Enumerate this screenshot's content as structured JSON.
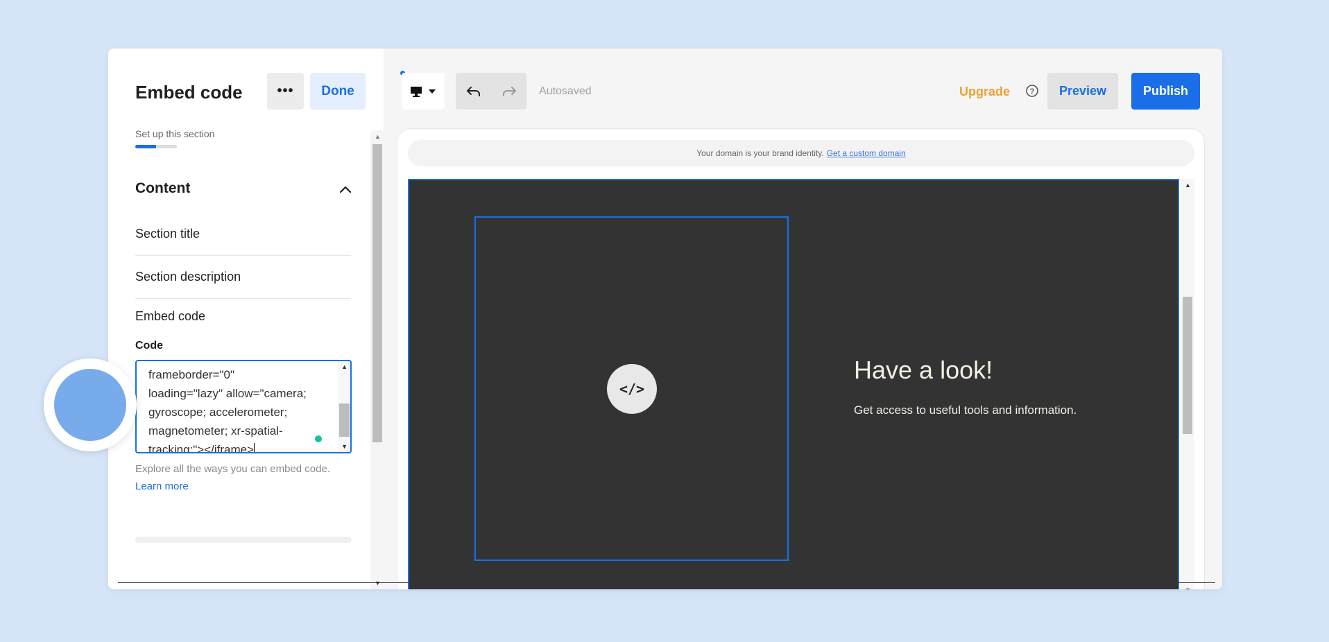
{
  "left_panel": {
    "title": "Embed code",
    "more_label": "•••",
    "done_label": "Done",
    "setup_label": "Set up this section",
    "setup_progress": 0.5,
    "content_heading": "Content",
    "section_title_label": "Section title",
    "section_description_label": "Section description",
    "embed_code_label": "Embed code",
    "code_label": "Code",
    "code_value": "frameborder=\"0\"\nloading=\"lazy\" allow=\"camera;\ngyroscope; accelerometer;\nmagnetometer; xr-spatial-\ntracking;\"></iframe>",
    "help_text": "Explore all the ways you can embed code.",
    "learn_more": "Learn more"
  },
  "topbar": {
    "device_icon": "desktop-icon",
    "undo_icon": "undo-icon",
    "redo_icon": "redo-icon",
    "autosaved": "Autosaved",
    "upgrade": "Upgrade",
    "help_icon": "help-icon",
    "preview_label": "Preview",
    "publish_label": "Publish"
  },
  "preview": {
    "domain_text": "Your domain is your brand identity.",
    "domain_link": "Get a custom domain",
    "embed_icon": "</>",
    "section_title": "Have a look!",
    "section_description": "Get access to useful tools and information."
  },
  "colors": {
    "accent": "#1a6ee8",
    "upgrade": "#f0a030",
    "section_bg": "#333333",
    "page_bg": "#d5e4f7"
  }
}
